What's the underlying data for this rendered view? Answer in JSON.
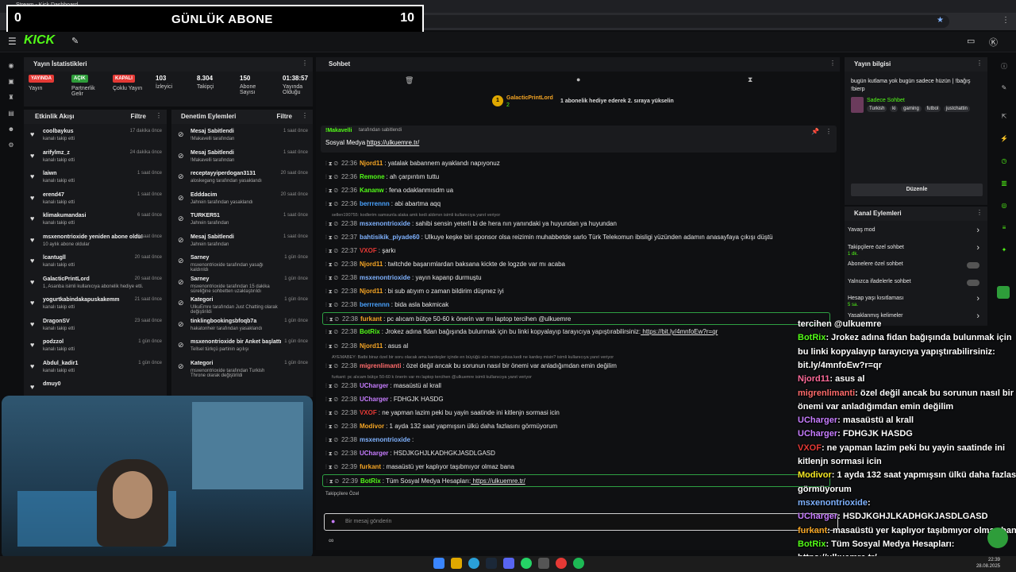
{
  "browser": {
    "tab_title": "Stream - Kick Dashboard",
    "url": "https://dashboard.kick.com/stream"
  },
  "overlay": {
    "left_count": "0",
    "title": "GÜNLÜK ABONE",
    "right_count": "10"
  },
  "kick": {
    "logo": "KICK"
  },
  "stats": {
    "title": "Yayın İstatistikleri",
    "items": [
      {
        "badge": "YAYINDA",
        "label": "Yayın",
        "color": "#e53935"
      },
      {
        "badge": "AÇIK",
        "label": "Partnerlik Gelir",
        "color": "#2e9d3a"
      },
      {
        "badge": "KAPALI",
        "label": "Çoklu Yayın",
        "color": "#e53935"
      },
      {
        "value": "103",
        "label": "İzleyici"
      },
      {
        "value": "8.304",
        "label": "Takipçi"
      },
      {
        "value": "150",
        "label": "Abone Sayısı"
      },
      {
        "value": "01:38:57",
        "label": "Yayında Olduğu"
      }
    ]
  },
  "activity": {
    "title": "Etkinlik Akışı",
    "filter": "Filtre",
    "items": [
      {
        "name": "coolbaykus",
        "sub": "kanalı takip etti",
        "time": "17 dakika önce"
      },
      {
        "name": "arifylmz_z",
        "sub": "kanalı takip etti",
        "time": "24 dakika önce"
      },
      {
        "name": "laiwn",
        "sub": "kanalı takip etti",
        "time": "1 saat önce"
      },
      {
        "name": "erend47",
        "sub": "kanalı takip etti",
        "time": "1 saat önce"
      },
      {
        "name": "klimakumandasi",
        "sub": "kanalı takip etti",
        "time": "6 saat önce"
      },
      {
        "name": "msxenontrioxide yeniden abone oldu!",
        "sub": "10 aylık abone oldular",
        "time": "9 saat önce"
      },
      {
        "name": "lcantugll",
        "sub": "kanalı takip etti",
        "time": "20 saat önce"
      },
      {
        "name": "GalacticPrintLord",
        "sub": "1, Asanba isimli kullanıcıya abonelik hediye etti.",
        "time": "20 saat önce"
      },
      {
        "name": "yogurtkabindakapuskakemm",
        "sub": "kanalı takip etti",
        "time": "21 saat önce"
      },
      {
        "name": "DragonSV",
        "sub": "kanalı takip etti",
        "time": "23 saat önce"
      },
      {
        "name": "podzzol",
        "sub": "kanalı takip etti",
        "time": "1 gün önce"
      },
      {
        "name": "Abdul_kadir1",
        "sub": "kanalı takip etti",
        "time": "1 gün önce"
      },
      {
        "name": "dmuy0",
        "sub": "",
        "time": ""
      }
    ]
  },
  "modlog": {
    "title": "Denetim Eylemleri",
    "filter": "Filtre",
    "items": [
      {
        "name": "Mesaj Sabitlendi",
        "sub": "!Makavelli tarafından",
        "time": "1 saat önce"
      },
      {
        "name": "Mesaj Sabitlendi",
        "sub": "!Makavelli tarafından",
        "time": "1 saat önce"
      },
      {
        "name": "receptayyiperdogan3131",
        "sub": "aloskegang tarafından yasaklandı",
        "time": "20 saat önce"
      },
      {
        "name": "Edddacim",
        "sub": "Jahrein tarafından yasaklandı",
        "time": "20 saat önce"
      },
      {
        "name": "TURKER51",
        "sub": "Jahrein tarafından",
        "time": "1 saat önce"
      },
      {
        "name": "Mesaj Sabitlendi",
        "sub": "Jahrein tarafından",
        "time": "1 saat önce"
      },
      {
        "name": "Sarney",
        "sub": "msxenontrioxide tarafından yasağı kaldırıldı",
        "time": "1 gün önce"
      },
      {
        "name": "Sarney",
        "sub": "msxenontrioxide tarafından 15 dakika süreliğine sohbetten uzaklaştırıldı",
        "time": "1 gün önce"
      },
      {
        "name": "Kategori",
        "sub": "UlkuEmre tarafından Just Chatting olarak değiştirildi",
        "time": "1 gün önce"
      },
      {
        "name": "tinklingbookingsbfoqb7a",
        "sub": "hakatonheir tarafından yasaklandı",
        "time": "1 gün önce"
      },
      {
        "name": "msxenontrioxide bir Anket başlattı",
        "sub": "Tellsel türkçü partinin açılışı",
        "time": "1 gün önce"
      },
      {
        "name": "Kategori",
        "sub": "msxenontrioxide tarafından Turkish Throne olarak değiştirildi",
        "time": "1 gün önce"
      }
    ]
  },
  "chat": {
    "title": "Sohbet",
    "gift_user": "GalacticPrintLord",
    "gift_count": "2",
    "gift_text": "1 abonelik hediye ederek 2. sıraya yükselin",
    "pinned_by": "!Makavelli",
    "pinned_by_suffix": "tarafından sabitlendi",
    "pinned_label": "Sosyal Medya :",
    "pinned_link": "https://ulkuemre.tr/",
    "messages": [
      {
        "time": "22:36",
        "user": "Njord11",
        "color": "#f5a524",
        "text": "yatalak babannem ayaklandı napıyonuz"
      },
      {
        "time": "22:36",
        "user": "Remone",
        "color": "#53fc18",
        "text": "ah çarpıntım tuttu"
      },
      {
        "time": "22:36",
        "user": "Kananw",
        "color": "#53fc18",
        "text": "fena odaklanmısdm ua"
      },
      {
        "time": "22:36",
        "user": "berrrennn",
        "color": "#4aa3ff",
        "text": "abi abartma aqq"
      },
      {
        "time": "22:38",
        "user": "msxenontrioxide",
        "color": "#7fb2ff",
        "text": "sahibi sensin yeterli bi de hera nın yanındaki ya huyundan ya huyundan"
      },
      {
        "time": "22:37",
        "user": "bahtisikik_piyade60",
        "color": "#7fb2ff",
        "text": "Ulkuye keşke biri sponsor olsa reizimin muhabbetde sarlo Türk Telekomun ibisligi yüzünden adamın anasayfaya çıkışı düştü"
      },
      {
        "time": "22:37",
        "user": "VXOF",
        "color": "#e53935",
        "text": "şarkı"
      },
      {
        "time": "22:38",
        "user": "Njord11",
        "color": "#f5a524",
        "text": "twitchde başarımlardan baksana kickte de logzde var mı acaba"
      },
      {
        "time": "22:38",
        "user": "msxenontrioxide",
        "color": "#7fb2ff",
        "text": "yayın kapanp durmuştu"
      },
      {
        "time": "22:38",
        "user": "Njord11",
        "color": "#f5a524",
        "text": "bi sub atıyım o zaman bildirim düşmez iyi"
      },
      {
        "time": "22:38",
        "user": "berrrennn",
        "color": "#4aa3ff",
        "text": "bida asla bakmicak"
      },
      {
        "time": "22:38",
        "user": "furkant",
        "color": "#f5a524",
        "text": "pc alıcam bütçe 50-60 k önerin var mı laptop tercihen @ulkuemre"
      },
      {
        "time": "22:38",
        "user": "BotRix",
        "color": "#53fc18",
        "text": "Jrokez adına fidan bağışında bulunmak için bu linki kopyalayıp tarayıcıya yapıştırabilirsiniz:",
        "link": "https://bit.ly/4mnfoEw?r=qr"
      },
      {
        "time": "22:38",
        "user": "Njord11",
        "color": "#f5a524",
        "text": "asus al"
      },
      {
        "time": "22:38",
        "user": "migrenlimanti",
        "color": "#ff6b6b",
        "text": "özel değil ancak bu sorunun nasıl bir önemi var anladığımdan emin değilim"
      },
      {
        "time": "22:38",
        "user": "UCharger",
        "color": "#c77dff",
        "text": "masaüstü al krall"
      },
      {
        "time": "22:38",
        "user": "UCharger",
        "color": "#c77dff",
        "text": "FDHGJK HASDG"
      },
      {
        "time": "22:38",
        "user": "VXOF",
        "color": "#e53935",
        "text": "ne yapman lazim peki bu yayin saatinde ini kitlenjn sormasi icin"
      },
      {
        "time": "22:38",
        "user": "Modivor",
        "color": "#f5a524",
        "text": "1 ayda 132 saat yapmışsın ülkü daha fazlasını görmüyorum"
      },
      {
        "time": "22:38",
        "user": "msxenontrioxide",
        "color": "#7fb2ff",
        "text": ""
      },
      {
        "time": "22:38",
        "user": "UCharger",
        "color": "#c77dff",
        "text": "HSDJKGHJLKADHGKJASDLGASD"
      },
      {
        "time": "22:39",
        "user": "furkant",
        "color": "#f5a524",
        "text": "masaüstü yer kaplıyor taşıbmıyor olmaz bana"
      },
      {
        "time": "22:39",
        "user": "BotRix",
        "color": "#53fc18",
        "text": "Tüm Sosyal Medya Hesapları:",
        "link": "https://ulkuemre.tr/"
      }
    ],
    "reply_note_1": "sellen190755: kodlerim samsunla alaka amk kedi aldımın isimli kullanıcıya yanıt veriyor",
    "reply_note_2": "AYEMABEY: Batbi biraz özel bir soru olacak ama kardeşler içinde en büyüğü sün misin yoksa kedi ne kardeş misin? isimli kullanıcıya yanıt veriyor",
    "reply_note_3": "furkant: pc alıcam bütçe 50-60 k önerin var mı laptop tercihen @ulkuemre isimli kullanıcıya yanıt veriyor",
    "followers_only": "Takipçilere Özel",
    "input_placeholder": "Bir mesaj gönderin"
  },
  "streaminfo": {
    "title": "Yayın bilgisi",
    "stream_title": "bugün kutlama yok bugün sadece hüzün | !bağış !bierp",
    "category": "Sadece Sohbet",
    "tags": [
      "Turkish",
      "ki",
      "gaming",
      "futbol",
      "justchattin"
    ],
    "edit": "Düzenle"
  },
  "chanev": {
    "title": "Kanal Eylemleri",
    "items": [
      {
        "label": "Yavaş mod",
        "sub": ""
      },
      {
        "label": "Takipçilere özel sohbet",
        "sub": "1 dk."
      },
      {
        "label": "Abonelere özel sohbet",
        "sub": ""
      },
      {
        "label": "Yalnızca ifadelerle sohbet",
        "sub": ""
      },
      {
        "label": "Hesap yaşı kısıtlaması",
        "sub": "5 sa."
      },
      {
        "label": "Yasaklanmış kelimeler",
        "sub": ""
      }
    ]
  },
  "overlay_chat": [
    {
      "user": "",
      "text": "tercihen @ulkuemre",
      "color": "#fff"
    },
    {
      "user": "BotRix",
      "text": ": Jrokez adına fidan bağışında bulunmak için",
      "color": "#53fc18"
    },
    {
      "user": "",
      "text": "bu linki kopyalayıp tarayıcıya yapıştırabilirsiniz:",
      "color": "#fff"
    },
    {
      "user": "",
      "text": "bit.ly/4mnfoEw?r=qr",
      "color": "#fff"
    },
    {
      "user": "Njord11",
      "text": ": asus al",
      "color": "#ff6b9a"
    },
    {
      "user": "migrenlimanti",
      "text": ": özel değil ancak bu sorunun nasıl bir",
      "color": "#ff6b6b"
    },
    {
      "user": "",
      "text": "önemi var anladığımdan emin değilim",
      "color": "#fff"
    },
    {
      "user": "UCharger",
      "text": ": masaüstü al krall",
      "color": "#c77dff"
    },
    {
      "user": "UCharger",
      "text": ": FDHGJK HASDG",
      "color": "#c77dff"
    },
    {
      "user": "VXOF",
      "text": ": ne yapman lazim peki bu yayin saatinde ini",
      "color": "#e53935"
    },
    {
      "user": "",
      "text": "kitlenjn sormasi icin",
      "color": "#fff"
    },
    {
      "user": "Modivor",
      "text": ": 1 ayda 132 saat yapmışsın ülkü daha fazlasını",
      "color": "#f5e524"
    },
    {
      "user": "",
      "text": "görmüyorum",
      "color": "#fff"
    },
    {
      "user": "msxenontrioxide",
      "text": ":",
      "color": "#7fb2ff"
    },
    {
      "user": "UCharger",
      "text": ": HSDJKGHJLKADHGKJASDLGASD",
      "color": "#c77dff"
    },
    {
      "user": "furkant",
      "text": ": masaüstü yer kaplıyor taşıbmıyor olmaz bana",
      "color": "#f5a524"
    },
    {
      "user": "BotRix",
      "text": ": Tüm Sosyal Medya Hesapları:",
      "color": "#53fc18"
    },
    {
      "user": "",
      "text": "https://ulkuemre.tr/",
      "color": "#fff"
    }
  ],
  "taskbar": {
    "time": "22:39",
    "date": "28.08.2025"
  }
}
